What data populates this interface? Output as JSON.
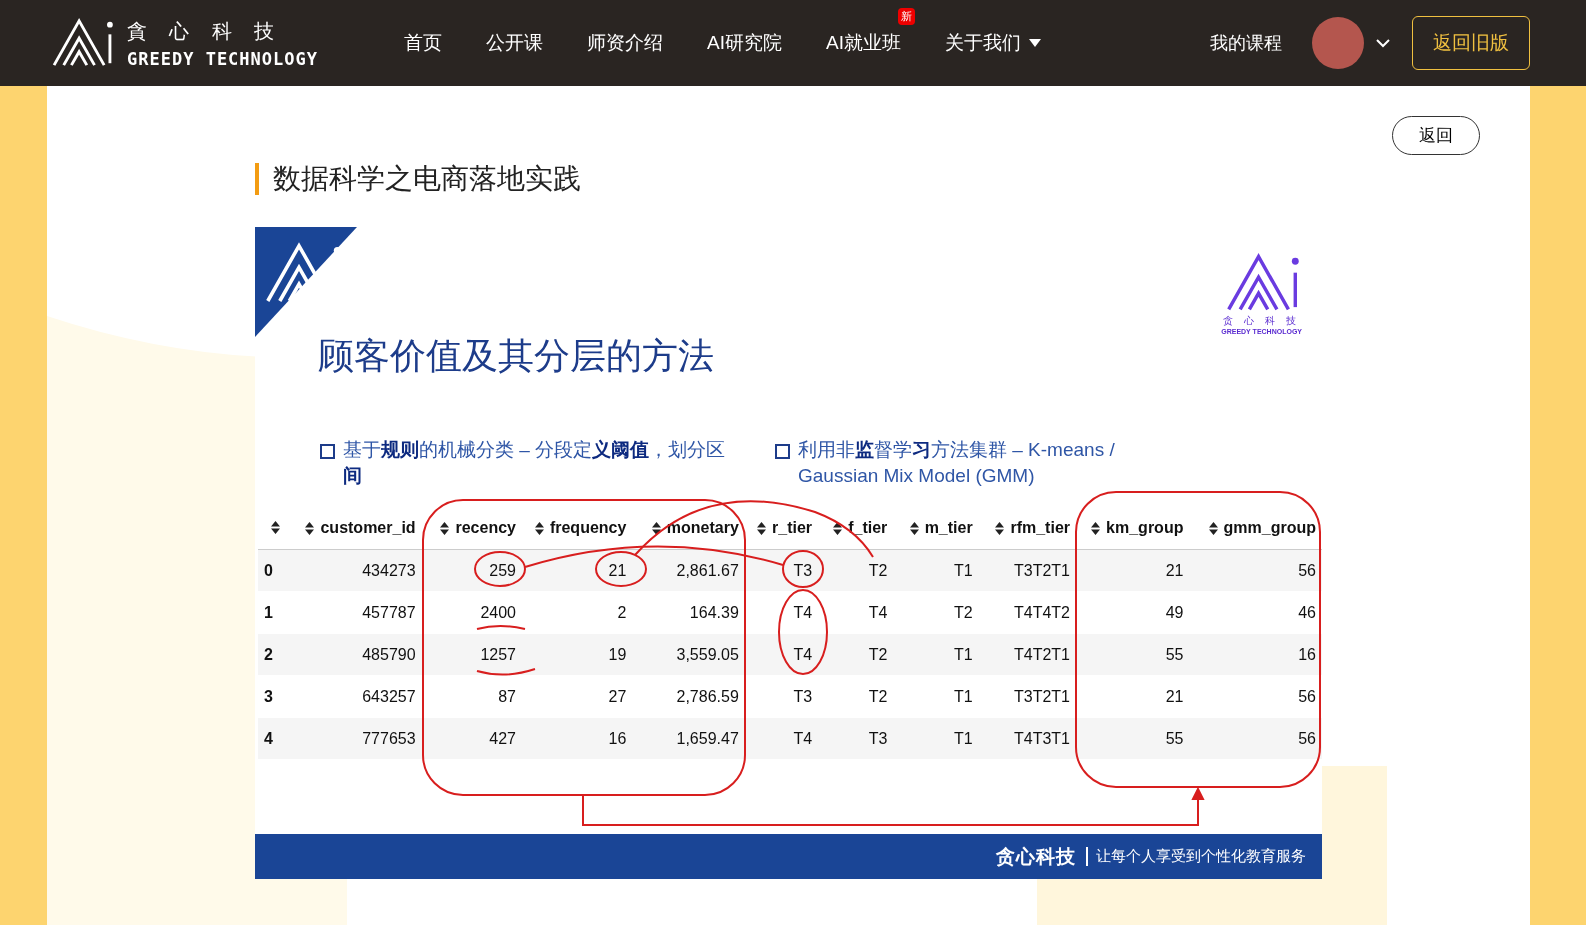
{
  "header": {
    "logo": {
      "chars": "貪 心 科 技",
      "name": "GREEDY TECHNOLOGY"
    },
    "nav": [
      {
        "label": "首页"
      },
      {
        "label": "公开课"
      },
      {
        "label": "师资介绍"
      },
      {
        "label": "AI研究院"
      },
      {
        "label": "AI就业班",
        "badge": "新"
      },
      {
        "label": "关于我们",
        "has_menu": true
      }
    ],
    "my_courses": "我的课程",
    "old_version": "返回旧版"
  },
  "back_button": "返回",
  "page_title": "数据科学之电商落地实践",
  "slide": {
    "logo": {
      "chars": "贪 心 科 技",
      "name": "GREEDY TECHNOLOGY"
    },
    "title": "顾客价值及其分层的方法",
    "bullets": [
      "基于**规则**的机械分类 – 分段定**义阈值**，划分区**间**",
      "利用非**监**督学**习**方法集群 – K-means / Gaussian Mix Model (GMM)"
    ],
    "table": {
      "columns": [
        "",
        "customer_id",
        "recency",
        "frequency",
        "monetary",
        "r_tier",
        "f_tier",
        "m_tier",
        "rfm_tier",
        "km_group",
        "gmm_group"
      ],
      "rows": [
        [
          "0",
          "434273",
          "259",
          "21",
          "2,861.67",
          "T3",
          "T2",
          "T1",
          "T3T2T1",
          "21",
          "56"
        ],
        [
          "1",
          "457787",
          "2400",
          "2",
          "164.39",
          "T4",
          "T4",
          "T2",
          "T4T4T2",
          "49",
          "46"
        ],
        [
          "2",
          "485790",
          "1257",
          "19",
          "3,559.05",
          "T4",
          "T2",
          "T1",
          "T4T2T1",
          "55",
          "16"
        ],
        [
          "3",
          "643257",
          "87",
          "27",
          "2,786.59",
          "T3",
          "T2",
          "T1",
          "T3T2T1",
          "21",
          "56"
        ],
        [
          "4",
          "777653",
          "427",
          "16",
          "1,659.47",
          "T4",
          "T3",
          "T1",
          "T4T3T1",
          "55",
          "56"
        ]
      ]
    },
    "footer": {
      "brand": "贪心科技",
      "slogan": "让每个人享受到个性化教育服务"
    }
  }
}
